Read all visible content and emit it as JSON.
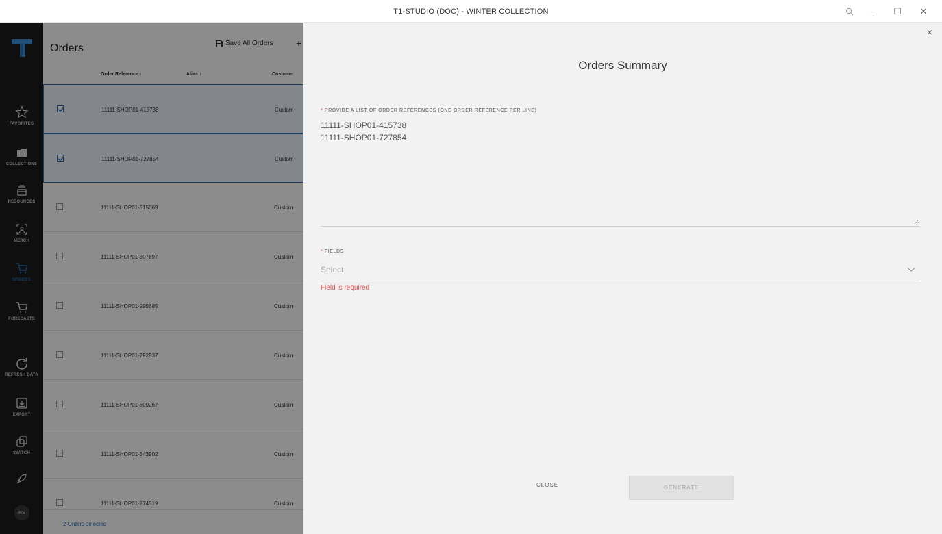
{
  "window": {
    "title": "T1-STUDIO (DOC) - WINTER COLLECTION",
    "search_icon": "magnifier-icon",
    "minimize": "−",
    "maximize": "☐",
    "close": "✕"
  },
  "sidebar": {
    "items": [
      {
        "label": "FAVORITES",
        "icon": "star-icon"
      },
      {
        "label": "COLLECTIONS",
        "icon": "folder-icon"
      },
      {
        "label": "RESOURCES",
        "icon": "inbox-icon"
      },
      {
        "label": "MERCH",
        "icon": "merch-icon"
      },
      {
        "label": "ORDERS",
        "icon": "cart-icon",
        "active": true
      },
      {
        "label": "FORECASTS",
        "icon": "cart-icon"
      },
      {
        "label": "REFRESH DATA",
        "icon": "refresh-icon"
      },
      {
        "label": "EXPORT",
        "icon": "download-icon"
      },
      {
        "label": "SWITCH",
        "icon": "switch-icon"
      }
    ],
    "avatar": "RS"
  },
  "orders": {
    "title": "Orders",
    "save_all": "Save All Orders",
    "add": "+",
    "columns": {
      "order_reference": "Order Reference ↕",
      "alias": "Alias ↕",
      "customer": "Custome"
    },
    "rows": [
      {
        "ref": "11111-SHOP01-415738",
        "customer": "Custom",
        "selected": true
      },
      {
        "ref": "11111-SHOP01-727854",
        "customer": "Custom",
        "selected": true
      },
      {
        "ref": "11111-SHOP01-515069",
        "customer": "Custom",
        "selected": false
      },
      {
        "ref": "11111-SHOP01-307697",
        "customer": "Custom",
        "selected": false
      },
      {
        "ref": "11111-SHOP01-995685",
        "customer": "Custom",
        "selected": false
      },
      {
        "ref": "11111-SHOP01-792937",
        "customer": "Custom",
        "selected": false
      },
      {
        "ref": "11111-SHOP01-609267",
        "customer": "Custom",
        "selected": false
      },
      {
        "ref": "11111-SHOP01-343902",
        "customer": "Custom",
        "selected": false
      },
      {
        "ref": "11111-SHOP01-274519",
        "customer": "Custom",
        "selected": false
      }
    ],
    "footer": "2 Orders selected"
  },
  "panel": {
    "title": "Orders Summary",
    "close_icon": "×",
    "refs_label": "PROVIDE A LIST OF ORDER REFERENCES (ONE ORDER REFERENCE PER LINE)",
    "refs_lines": [
      "11111-SHOP01-415738",
      "11111-SHOP01-727854"
    ],
    "required_mark": "*",
    "fields_label": "FIELDS",
    "fields_placeholder": "Select",
    "fields_error": "Field is required",
    "close_button": "CLOSE",
    "generate_button": "GENERATE"
  },
  "colors": {
    "sidebar_bg": "#1d1d1d",
    "accent": "#2a6db0",
    "error": "#e05050",
    "panel_bg": "#f2f2f2"
  }
}
